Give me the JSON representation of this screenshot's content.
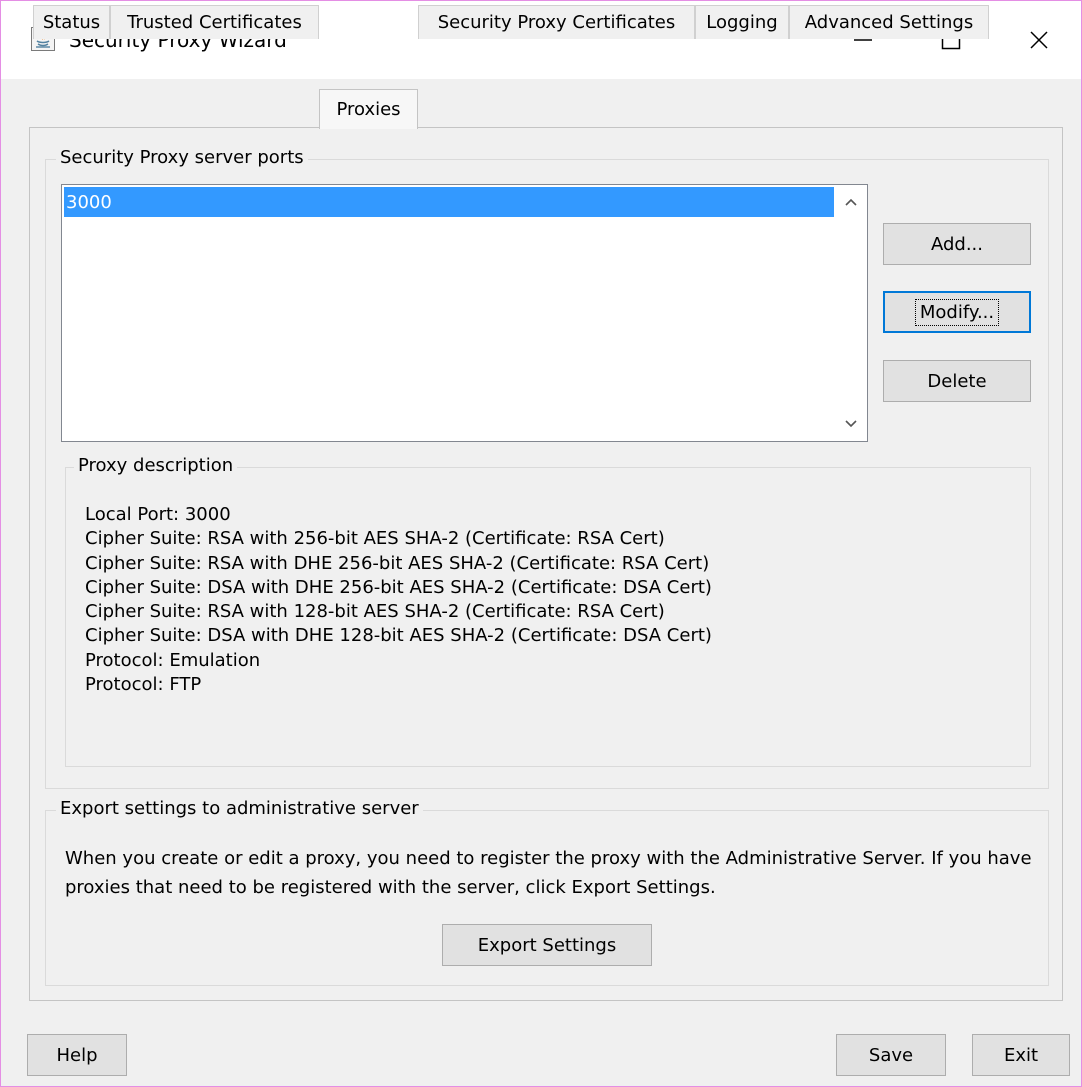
{
  "window": {
    "title": "Security Proxy Wizard",
    "icon": "java-icon"
  },
  "tabs": [
    {
      "label": "Status"
    },
    {
      "label": "Trusted Certificates"
    },
    {
      "label": "Proxies",
      "active": true
    },
    {
      "label": "Security Proxy Certificates"
    },
    {
      "label": "Logging"
    },
    {
      "label": "Advanced Settings"
    }
  ],
  "ports": {
    "group_title": "Security Proxy server ports",
    "items": [
      "3000"
    ],
    "selected": "3000",
    "add_label": "Add...",
    "modify_label": "Modify...",
    "delete_label": "Delete"
  },
  "description": {
    "group_title": "Proxy description",
    "lines": [
      "Local Port: 3000",
      "Cipher Suite: RSA with 256-bit AES SHA-2 (Certificate: RSA Cert)",
      "Cipher Suite: RSA with DHE 256-bit AES SHA-2 (Certificate: RSA Cert)",
      "Cipher Suite: DSA with DHE 256-bit AES SHA-2 (Certificate: DSA Cert)",
      "Cipher Suite: RSA with 128-bit AES SHA-2 (Certificate: RSA Cert)",
      "Cipher Suite: DSA with DHE 128-bit AES SHA-2 (Certificate: DSA Cert)",
      "Protocol: Emulation",
      "Protocol: FTP"
    ]
  },
  "export": {
    "group_title": "Export settings to administrative server",
    "message": "When you create or edit a proxy, you need to register the proxy with the Administrative Server. If you have proxies that need to be registered with the server, click Export Settings.",
    "button_label": "Export Settings"
  },
  "footer": {
    "help_label": "Help",
    "save_label": "Save",
    "exit_label": "Exit"
  },
  "colors": {
    "selection": "#3399ff",
    "focus_border": "#0078d7",
    "window_border": "#e48ee4"
  }
}
